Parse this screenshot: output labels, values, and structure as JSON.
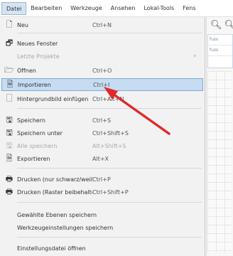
{
  "menubar": {
    "items": [
      "Datei",
      "Bearbeiten",
      "Werkzeuge",
      "Ansehen",
      "Lokal-Tools",
      "Fens"
    ]
  },
  "toolbar_right": {
    "zoom_icons": [
      "zoom-icon",
      "zoom-icon"
    ]
  },
  "side_panel": {
    "rows": [
      "fuss",
      "fuss"
    ]
  },
  "menu": {
    "new": {
      "label": "Neu",
      "shortcut": "Ctrl+N"
    },
    "new_window": {
      "label": "Neues Fenster"
    },
    "recent": {
      "label": "Letzte Projekte"
    },
    "open": {
      "label": "Öffnen",
      "shortcut": "Ctrl+O"
    },
    "import": {
      "label": "Importieren",
      "shortcut": "Ctrl+I"
    },
    "image_import": {
      "label": "Hintergrundbild einfügen",
      "shortcut": "Ctrl+Alt+N"
    },
    "save": {
      "label": "Speichern",
      "shortcut": "Ctrl+S"
    },
    "save_as": {
      "label": "Speichern unter",
      "shortcut": "Ctrl+Shift+S"
    },
    "save_all": {
      "label": "Alle speichern",
      "shortcut": "Alt+Shift+S"
    },
    "export": {
      "label": "Exportieren",
      "shortcut": "Alt+X"
    },
    "print_bw": {
      "label": "Drucken (nur schwarz/weiß)",
      "shortcut": "Ctrl+P"
    },
    "print_raster": {
      "label": "Drucken (Raster beibehalten)",
      "shortcut": "Ctrl+Shift+P"
    },
    "save_settings": {
      "label": "Gewählte Ebenen speichern"
    },
    "save_defaults": {
      "label": "Werkzeugeinstellungen speichern"
    },
    "open_settings": {
      "label": "Einstellungsdatei öffnen"
    }
  }
}
